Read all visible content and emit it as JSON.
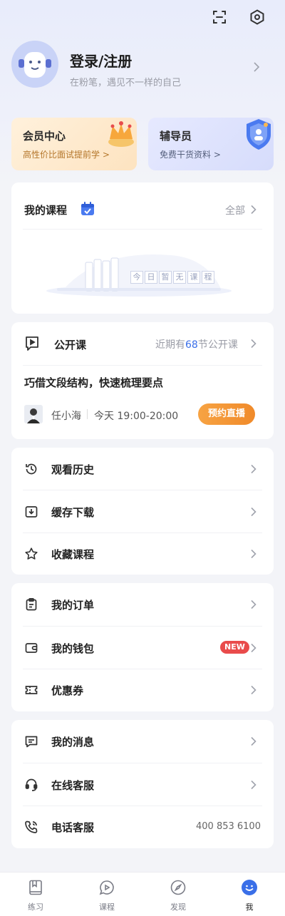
{
  "header": {
    "scan_icon": "scan-icon",
    "settings_icon": "hexagon-settings-icon"
  },
  "profile": {
    "title": "登录/注册",
    "subtitle": "在粉笔，遇见不一样的自己"
  },
  "promos": [
    {
      "title": "会员中心",
      "subtitle": "高性价比面试提前学 >"
    },
    {
      "title": "辅导员",
      "subtitle": "免费干货资料 >"
    }
  ],
  "my_courses": {
    "title": "我的课程",
    "all_label": "全部",
    "empty_chars": [
      "今",
      "日",
      "暂",
      "无",
      "课",
      "程"
    ]
  },
  "open_course": {
    "title": "公开课",
    "summary_prefix": "近期有",
    "summary_count": "68",
    "summary_suffix": "节公开课",
    "lesson_title": "巧借文段结构，快速梳理要点",
    "teacher": "任小海",
    "time": "今天 19:00-20:00",
    "book_label": "预约直播"
  },
  "group1": [
    {
      "label": "观看历史"
    },
    {
      "label": "缓存下载"
    },
    {
      "label": "收藏课程"
    }
  ],
  "group2": [
    {
      "label": "我的订单"
    },
    {
      "label": "我的钱包",
      "badge": "NEW"
    },
    {
      "label": "优惠券"
    }
  ],
  "group3": [
    {
      "label": "我的消息"
    },
    {
      "label": "在线客服"
    },
    {
      "label": "电话客服",
      "value": "400 853 6100"
    }
  ],
  "tabs": [
    {
      "label": "练习",
      "icon": "book-icon"
    },
    {
      "label": "课程",
      "icon": "play-bubble-icon"
    },
    {
      "label": "发现",
      "icon": "compass-icon"
    },
    {
      "label": "我",
      "icon": "smile-face-icon",
      "active": true
    }
  ],
  "colors": {
    "accent_blue": "#3a6fe8",
    "orange": "#f08a2a",
    "badge_red": "#e94b4b"
  }
}
